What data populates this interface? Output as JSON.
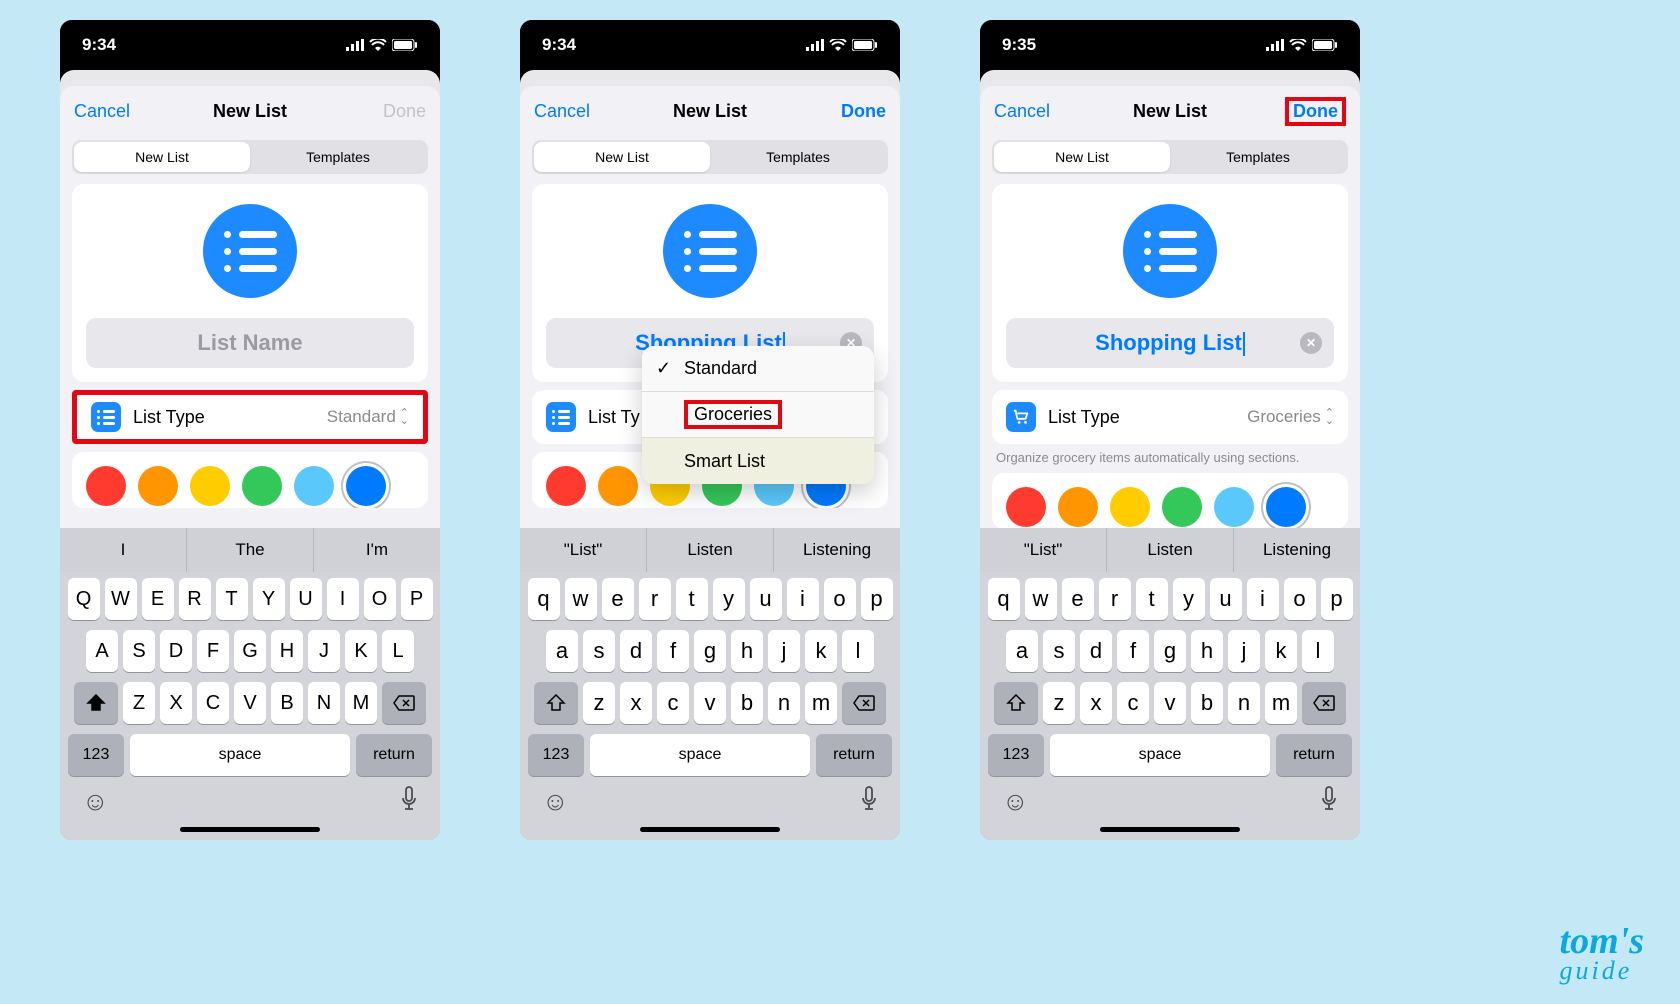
{
  "watermark": {
    "line1": "tom's",
    "line2": "guide"
  },
  "phones": [
    {
      "status": {
        "time": "9:34"
      },
      "nav": {
        "cancel": "Cancel",
        "title": "New List",
        "done": "Done",
        "done_enabled": false
      },
      "seg": {
        "opt1": "New List",
        "opt2": "Templates"
      },
      "name": {
        "placeholder": "List Name",
        "value": ""
      },
      "list_type": {
        "label": "List Type",
        "value": "Standard",
        "highlight": true,
        "icon_color": "#1d8aff",
        "icon_kind": "list"
      },
      "colors": [
        "#ff3b30",
        "#ff9500",
        "#ffcc00",
        "#34c759",
        "#5ac8fa",
        "#007aff"
      ],
      "selected_color_index": 5,
      "suggestions": [
        "I",
        "The",
        "I'm"
      ],
      "keyboard": {
        "case": "upper",
        "num": "123",
        "space": "space",
        "return": "return",
        "return_blue": false
      }
    },
    {
      "status": {
        "time": "9:34"
      },
      "nav": {
        "cancel": "Cancel",
        "title": "New List",
        "done": "Done",
        "done_enabled": true
      },
      "seg": {
        "opt1": "New List",
        "opt2": "Templates"
      },
      "name": {
        "placeholder": "",
        "value": "Shopping List"
      },
      "list_type": {
        "label": "List Ty",
        "value": "",
        "icon_color": "#1d8aff",
        "icon_kind": "list"
      },
      "dropdown": {
        "items": [
          {
            "label": "Standard",
            "checked": true
          },
          {
            "label": "Groceries",
            "highlight": true
          },
          {
            "label": "Smart List"
          }
        ]
      },
      "colors": [
        "#ff3b30",
        "#ff9500",
        "#ffcc00",
        "#34c759",
        "#5ac8fa",
        "#007aff"
      ],
      "selected_color_index": 5,
      "suggestions": [
        "\"List\"",
        "Listen",
        "Listening"
      ],
      "keyboard": {
        "case": "lower",
        "num": "123",
        "space": "space",
        "return": "return",
        "return_blue": false
      }
    },
    {
      "status": {
        "time": "9:35"
      },
      "nav": {
        "cancel": "Cancel",
        "title": "New List",
        "done": "Done",
        "done_enabled": true,
        "done_highlight": true
      },
      "seg": {
        "opt1": "New List",
        "opt2": "Templates"
      },
      "name": {
        "placeholder": "",
        "value": "Shopping List"
      },
      "list_type": {
        "label": "List Type",
        "value": "Groceries",
        "icon_color": "#1d8aff",
        "icon_kind": "cart",
        "hint": "Organize grocery items automatically using sections."
      },
      "colors": [
        "#ff3b30",
        "#ff9500",
        "#ffcc00",
        "#34c759",
        "#5ac8fa",
        "#007aff"
      ],
      "selected_color_index": 5,
      "suggestions": [
        "\"List\"",
        "Listen",
        "Listening"
      ],
      "keyboard": {
        "case": "lower",
        "num": "123",
        "space": "space",
        "return": "return",
        "return_blue": false
      }
    }
  ],
  "kb_rows": {
    "upper": [
      [
        "Q",
        "W",
        "E",
        "R",
        "T",
        "Y",
        "U",
        "I",
        "O",
        "P"
      ],
      [
        "A",
        "S",
        "D",
        "F",
        "G",
        "H",
        "J",
        "K",
        "L"
      ],
      [
        "Z",
        "X",
        "C",
        "V",
        "B",
        "N",
        "M"
      ]
    ],
    "lower": [
      [
        "q",
        "w",
        "e",
        "r",
        "t",
        "y",
        "u",
        "i",
        "o",
        "p"
      ],
      [
        "a",
        "s",
        "d",
        "f",
        "g",
        "h",
        "j",
        "k",
        "l"
      ],
      [
        "z",
        "x",
        "c",
        "v",
        "b",
        "n",
        "m"
      ]
    ]
  }
}
